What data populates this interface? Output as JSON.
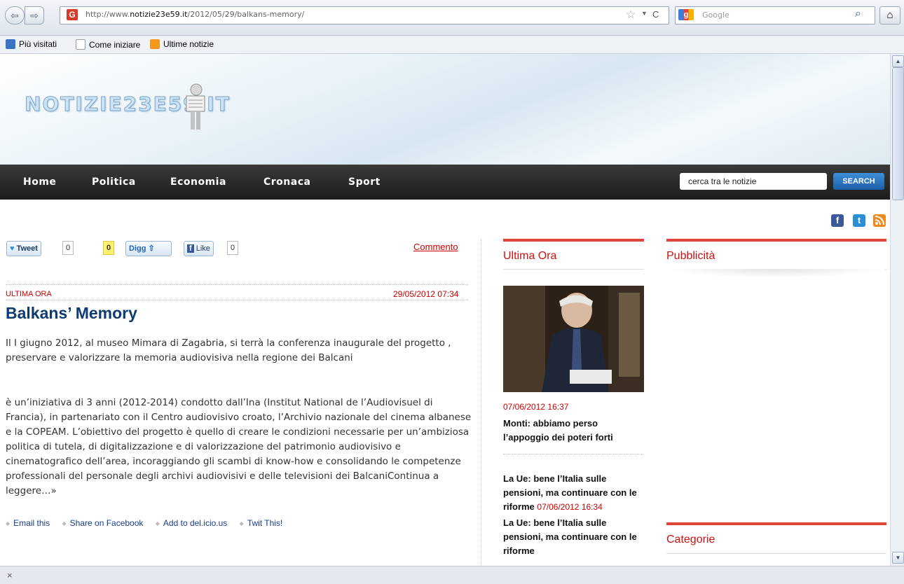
{
  "browser": {
    "url_prefix": "http://www.",
    "url_domain": "notizie23e59.it",
    "url_path": "/2012/05/29/balkans-memory/",
    "search_placeholder": "Google",
    "bookmarks": [
      "Più visitati",
      "Come iniziare",
      "Ultime notizie"
    ]
  },
  "site": {
    "logo_text": "NOTIZIE23E59.IT",
    "nav": [
      "Home",
      "Politica",
      "Economia",
      "Cronaca",
      "Sport"
    ],
    "search_value": "cerca tra le notizie",
    "search_button": "SEARCH",
    "social": {
      "facebook": "f",
      "twitter": "t",
      "rss": "rss"
    }
  },
  "share": {
    "tweet": "Tweet",
    "tweet_count": "0",
    "digg_count": "0",
    "digg": "Digg",
    "like": "Like",
    "like_count": "0",
    "comment": "Commento"
  },
  "post": {
    "category": "ULTIMA ORA",
    "date": "29/05/2012 07:34",
    "title": "Balkans’ Memory",
    "paragraph1": "Il I giugno 2012, al museo Mimara di Zagabria, si terrà la conferenza inaugurale del progetto , preservare e valorizzare la memoria audiovisiva nella regione dei Balcani",
    "paragraph2": "è un’iniziativa di 3 anni (2012-2014) condotto dall’Ina (Institut National de l’Audiovisuel di Francia), in partenariato con il Centro audiovisivo croato, l’Archivio nazionale del cinema albanese e la COPEAM. L’obiettivo del progetto è quello di creare le condizioni necessarie per un’ambiziosa politica di tutela, di digitalizzazione e di valorizzazione del patrimonio audiovisivo e cinematografico dell’area, incoraggiando gli scambi di know-how e consolidando le competenze professionali del personale degli archivi audiovisivi e delle televisioni dei BalcaniContinua a leggere…»",
    "share_links": [
      "Email this",
      "Share on Facebook",
      "Add to del.icio.us",
      "Twit This!"
    ]
  },
  "sidebar": {
    "ultima_ora_title": "Ultima Ora",
    "news1_date": "07/06/2012 16:37",
    "news1_title": "Monti: abbiamo perso l’appoggio dei poteri forti",
    "news2_title": "La Ue: bene l’Italia sulle pensioni, ma continuare con le riforme",
    "news2_date": "07/06/2012 16:34",
    "news3_title": "La Ue: bene l’Italia sulle pensioni, ma continuare con le riforme",
    "pubblicita_title": "Pubblicità",
    "categorie_title": "Categorie"
  },
  "status": {
    "close": "×"
  },
  "colors": {
    "accent_red": "#cc0000",
    "title_blue": "#0e3b73",
    "nav_dark": "#222222",
    "search_blue": "#2a78c6"
  }
}
